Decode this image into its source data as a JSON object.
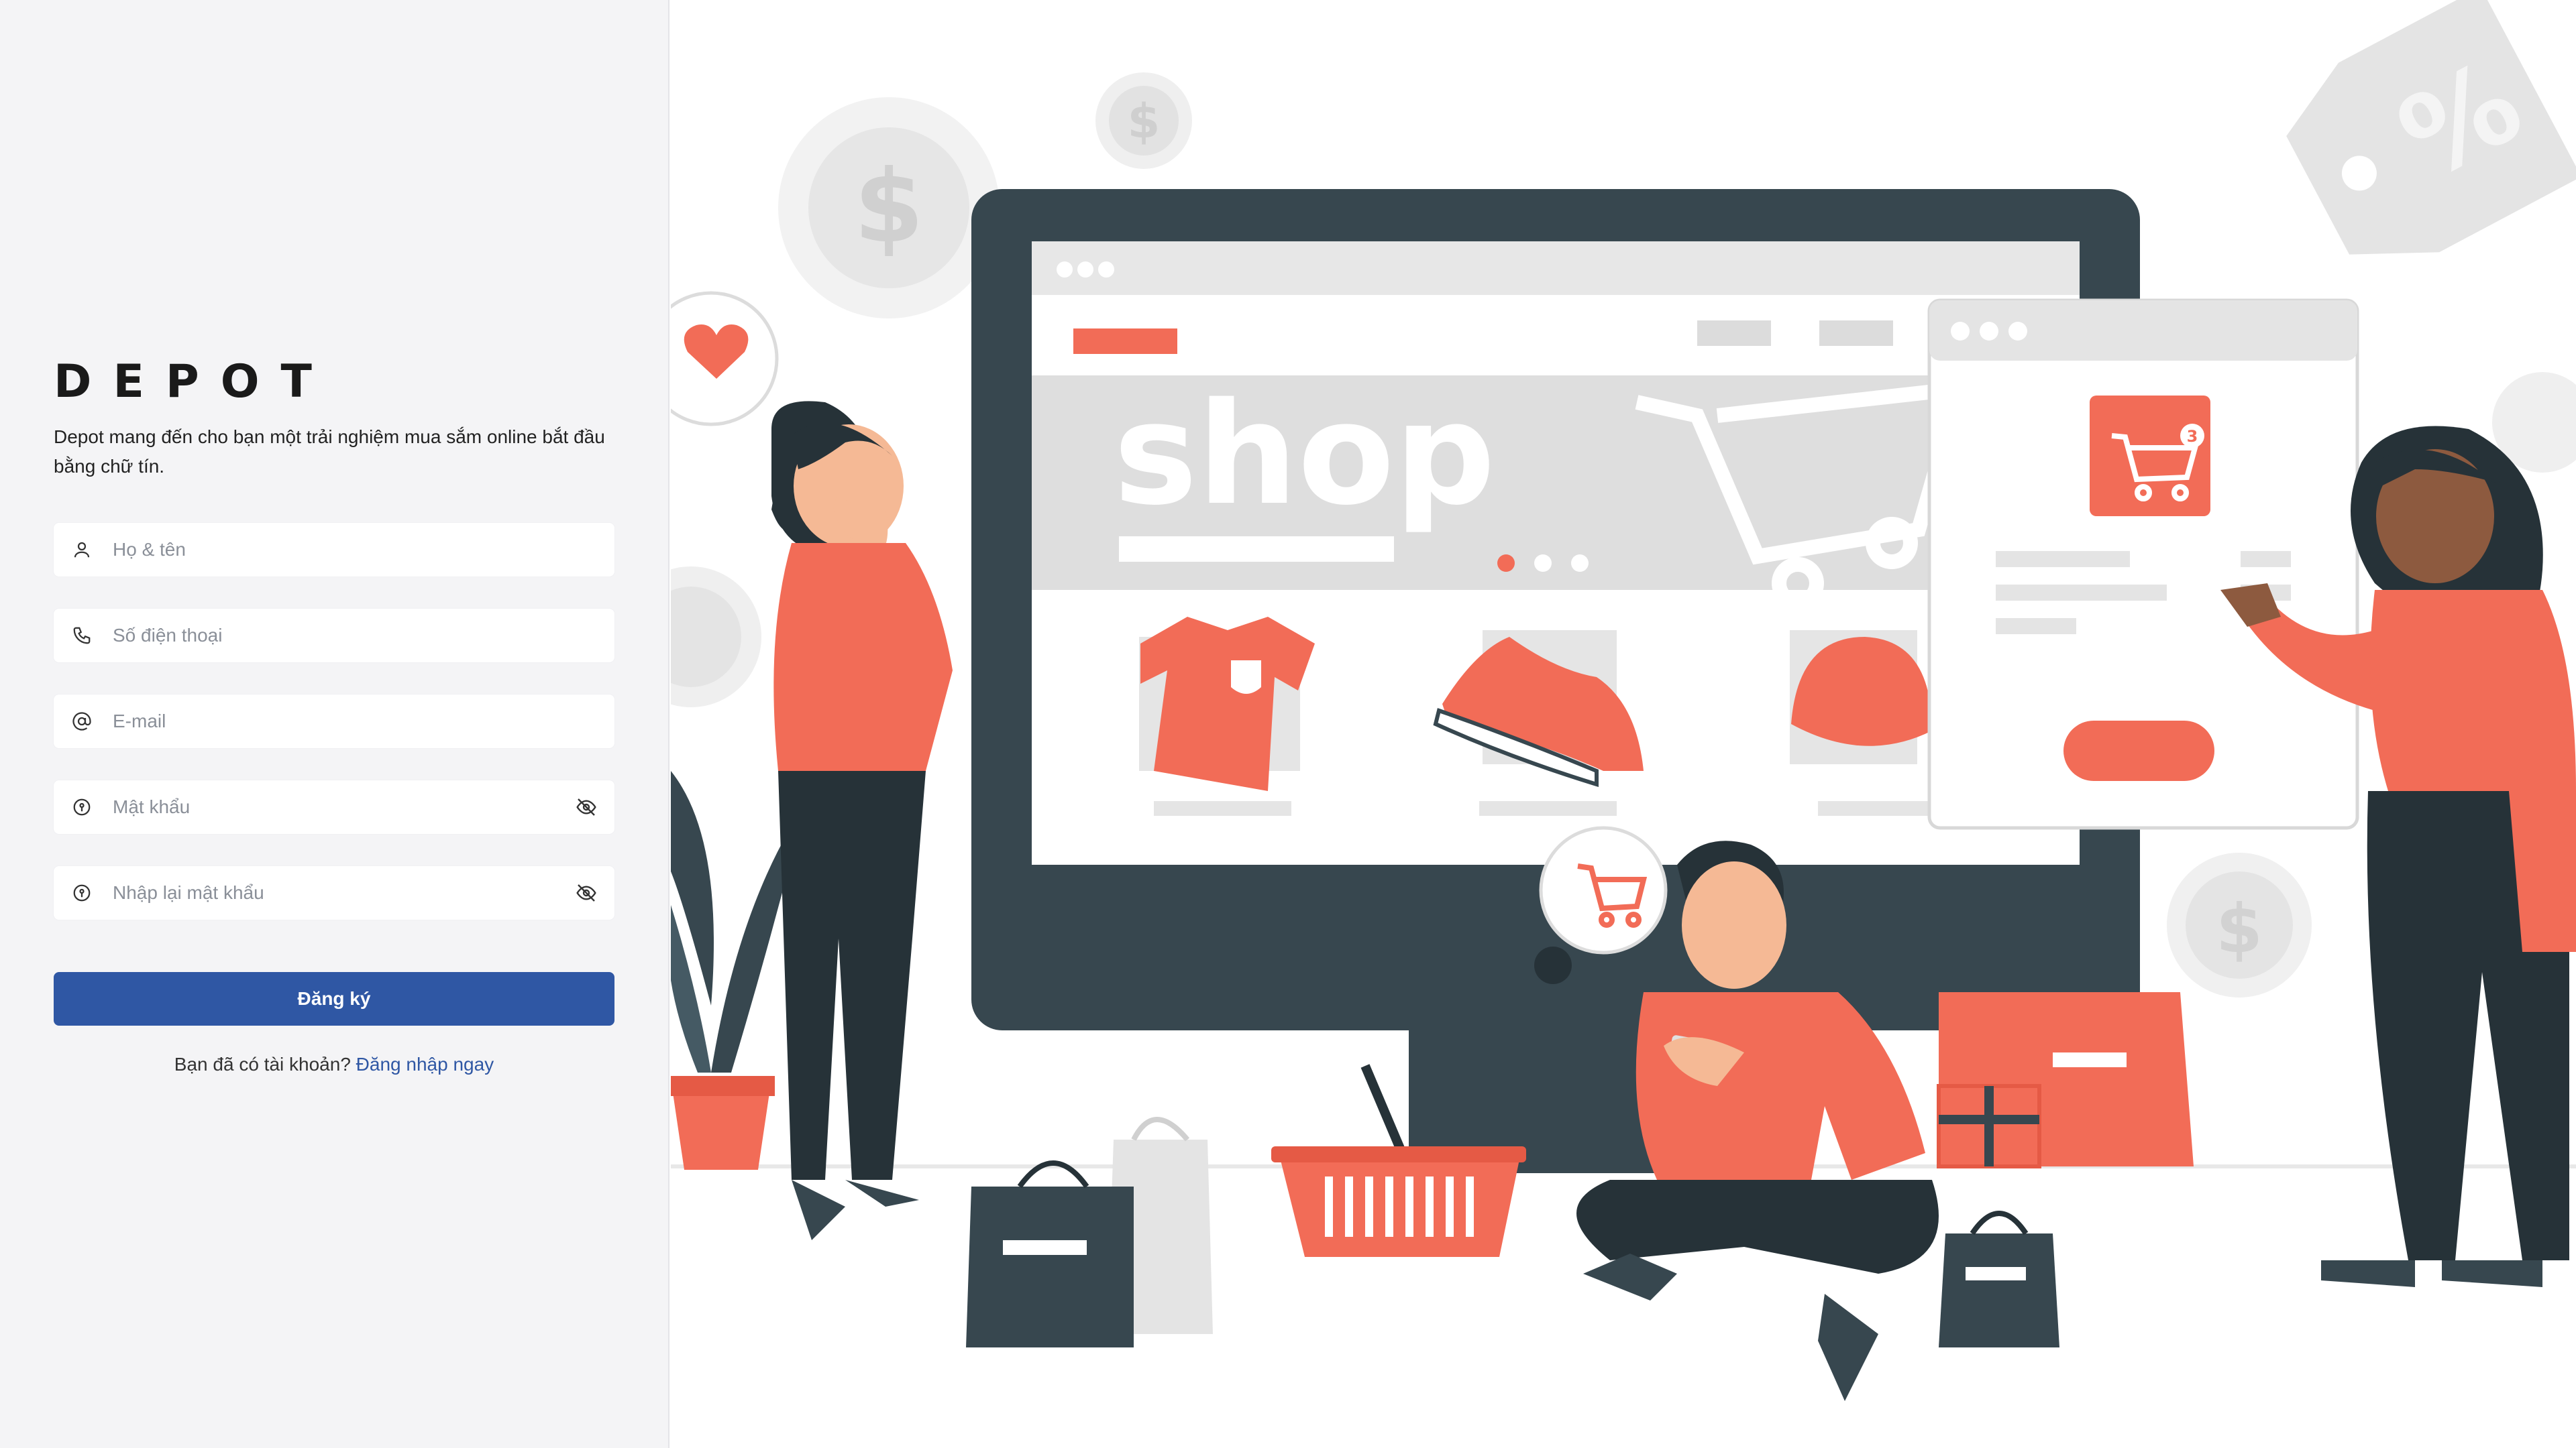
{
  "brand": {
    "name": "DEPOT"
  },
  "intro": {
    "tagline": "Depot mang đến cho bạn một trải nghiệm mua sắm online bắt đầu bằng chữ tín."
  },
  "form": {
    "fullname": {
      "placeholder": "Họ & tên",
      "icon": "user-icon"
    },
    "phone": {
      "placeholder": "Số điện thoại",
      "icon": "phone-icon"
    },
    "email": {
      "placeholder": "E-mail",
      "icon": "at-icon"
    },
    "password": {
      "placeholder": "Mật khẩu",
      "icon": "key-icon",
      "toggle_icon": "eye-off-icon"
    },
    "confirm_password": {
      "placeholder": "Nhập lại mật khẩu",
      "icon": "key-icon",
      "toggle_icon": "eye-off-icon"
    },
    "submit_label": "Đăng ký"
  },
  "login": {
    "prompt": "Bạn đã có tài khoản?",
    "link_label": "Đăng nhập ngay"
  },
  "illustration": {
    "screen_text": "shop",
    "cart_badge": "3",
    "symbol_percent": "%",
    "symbol_dollar": "$"
  },
  "colors": {
    "accent": "#2f57a4",
    "coral": "#f26c57",
    "dark_teal": "#37474f",
    "panel_bg": "#f4f4f6"
  }
}
